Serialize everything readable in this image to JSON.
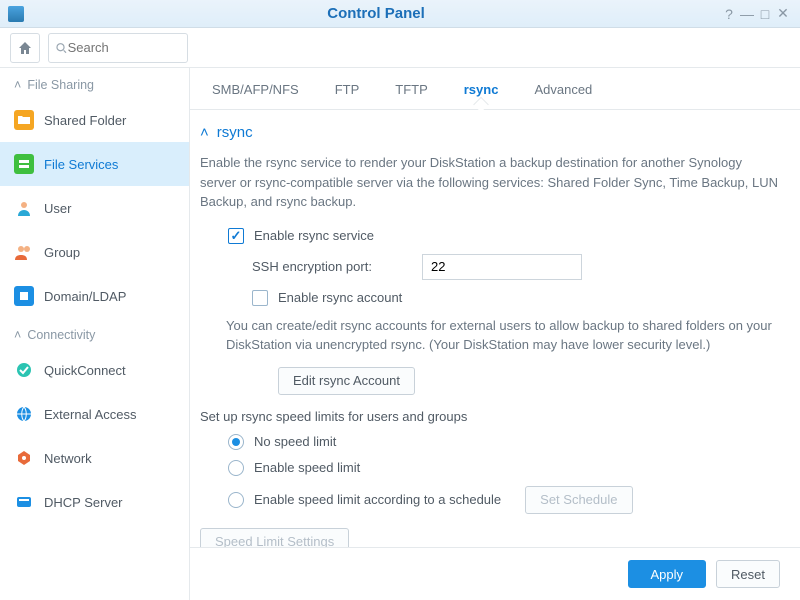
{
  "window": {
    "title": "Control Panel"
  },
  "search": {
    "placeholder": "Search"
  },
  "sidebar": {
    "sections": [
      {
        "label": "File Sharing"
      },
      {
        "label": "Connectivity"
      }
    ],
    "items": [
      {
        "label": "Shared Folder"
      },
      {
        "label": "File Services"
      },
      {
        "label": "User"
      },
      {
        "label": "Group"
      },
      {
        "label": "Domain/LDAP"
      },
      {
        "label": "QuickConnect"
      },
      {
        "label": "External Access"
      },
      {
        "label": "Network"
      },
      {
        "label": "DHCP Server"
      }
    ]
  },
  "tabs": [
    {
      "label": "SMB/AFP/NFS"
    },
    {
      "label": "FTP"
    },
    {
      "label": "TFTP"
    },
    {
      "label": "rsync"
    },
    {
      "label": "Advanced"
    }
  ],
  "section": {
    "title": "rsync",
    "desc": "Enable the rsync service to render your DiskStation a backup destination for another Synology server or rsync-compatible server via the following services: Shared Folder Sync, Time Backup, LUN Backup, and rsync backup.",
    "enable_label": "Enable rsync service",
    "ssh_label": "SSH encryption port:",
    "ssh_value": "22",
    "enable_account_label": "Enable rsync account",
    "account_desc": "You can create/edit rsync accounts for external users to allow backup to shared folders on your DiskStation via unencrypted rsync. (Your DiskStation may have lower security level.)",
    "edit_account_btn": "Edit rsync Account",
    "speed_intro": "Set up rsync speed limits for users and groups",
    "radio_none": "No speed limit",
    "radio_enable": "Enable speed limit",
    "radio_schedule": "Enable speed limit according to a schedule",
    "set_schedule_btn": "Set Schedule",
    "speed_settings_btn": "Speed Limit Settings"
  },
  "footer": {
    "apply": "Apply",
    "reset": "Reset"
  }
}
